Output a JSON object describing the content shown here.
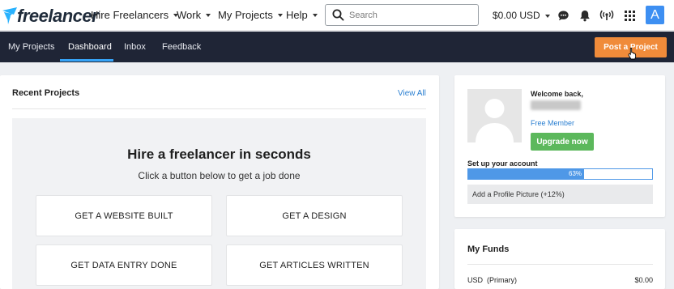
{
  "header": {
    "logo_text": "freelancer",
    "menus": [
      {
        "label": "Hire Freelancers"
      },
      {
        "label": "Work"
      },
      {
        "label": "My Projects"
      },
      {
        "label": "Help"
      }
    ],
    "search_placeholder": "Search",
    "balance": "$0.00 USD",
    "icons": [
      "chat-icon",
      "bell-icon",
      "broadcast-icon",
      "apps-grid-icon"
    ],
    "avatar_letter": "A",
    "accent": "#3d8ff2"
  },
  "subnav": {
    "items": [
      {
        "label": "My Projects"
      },
      {
        "label": "Dashboard",
        "active": true
      },
      {
        "label": "Inbox"
      },
      {
        "label": "Feedback"
      }
    ],
    "post_button": "Post a Project",
    "bar_color": "#1f2536",
    "button_color": "#f08b3a"
  },
  "recent_projects": {
    "title": "Recent Projects",
    "view_all": "View All",
    "hire_title": "Hire a freelancer in seconds",
    "hire_subtitle": "Click a button below to get a job done",
    "options": [
      "GET A WEBSITE BUILT",
      "GET A DESIGN",
      "GET DATA ENTRY DONE",
      "GET ARTICLES WRITTEN"
    ]
  },
  "profile": {
    "welcome": "Welcome back,",
    "membership": "Free Member",
    "upgrade_button": "Upgrade now",
    "setup_label": "Set up your account",
    "progress_percent": 63,
    "progress_label": "63%",
    "next_step": "Add a Profile Picture (+12%)"
  },
  "funds": {
    "title": "My Funds",
    "rows": [
      {
        "label": "USD  (Primary)",
        "value": "$0.00"
      }
    ]
  }
}
